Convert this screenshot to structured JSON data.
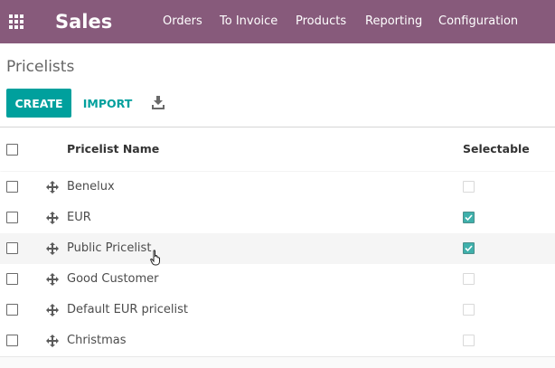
{
  "navbar": {
    "app_title": "Sales",
    "menu": [
      "Orders",
      "To Invoice",
      "Products",
      "Reporting",
      "Configuration"
    ],
    "color": "#875a7b"
  },
  "page": {
    "breadcrumb": "Pricelists",
    "create_label": "CREATE",
    "import_label": "IMPORT",
    "accent": "#00a09d"
  },
  "table": {
    "columns": [
      "Pricelist Name",
      "Selectable"
    ],
    "rows": [
      {
        "name": "Benelux",
        "selectable": false
      },
      {
        "name": "EUR",
        "selectable": true
      },
      {
        "name": "Public Pricelist",
        "selectable": true
      },
      {
        "name": "Good Customer",
        "selectable": false
      },
      {
        "name": "Default EUR pricelist",
        "selectable": false
      },
      {
        "name": "Christmas",
        "selectable": false
      }
    ]
  },
  "icons": {
    "apps": "apps-grid-icon",
    "download": "download-icon",
    "drag": "drag-handle-icon",
    "pointer": "hand-pointer-icon"
  }
}
